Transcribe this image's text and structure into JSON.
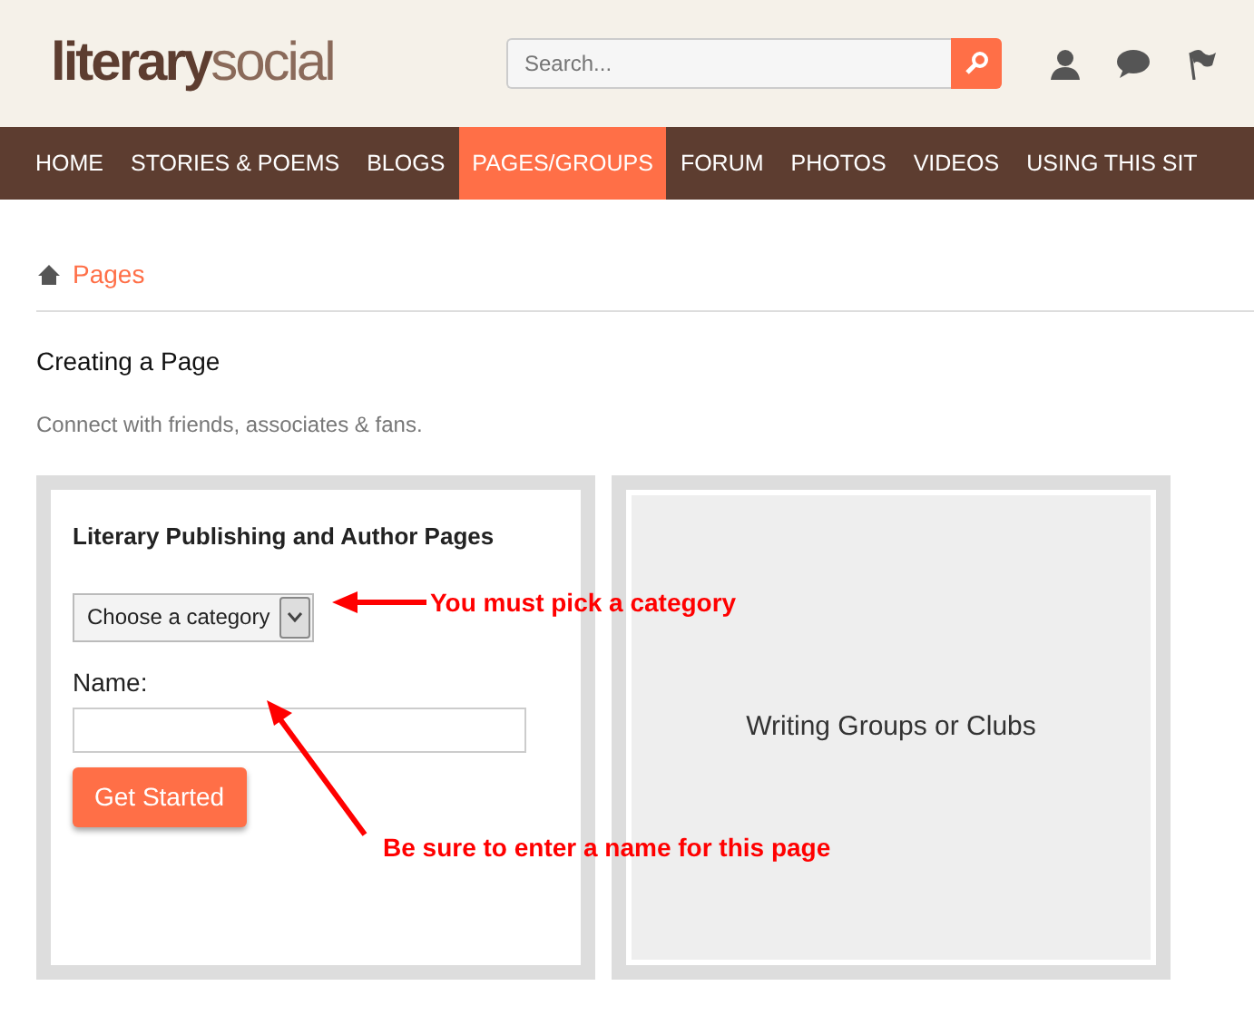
{
  "logo": {
    "strong": "literary",
    "light": "social"
  },
  "search": {
    "placeholder": "Search..."
  },
  "nav": [
    {
      "label": "HOME",
      "selected": false
    },
    {
      "label": "STORIES & POEMS",
      "selected": false
    },
    {
      "label": "BLOGS",
      "selected": false
    },
    {
      "label": "PAGES/GROUPS",
      "selected": true
    },
    {
      "label": "FORUM",
      "selected": false
    },
    {
      "label": "PHOTOS",
      "selected": false
    },
    {
      "label": "VIDEOS",
      "selected": false
    },
    {
      "label": "USING THIS SIT",
      "selected": false
    }
  ],
  "breadcrumb": "Pages",
  "heading": "Creating a Page",
  "subtitle": "Connect with friends, associates & fans.",
  "left_card": {
    "title": "Literary Publishing and Author Pages",
    "select": "Choose a category",
    "name_label": "Name:",
    "button": "Get Started"
  },
  "right_card": {
    "title": "Writing Groups or Clubs"
  },
  "annotations": [
    "You must pick a category",
    "Be sure to enter a name for this page"
  ]
}
